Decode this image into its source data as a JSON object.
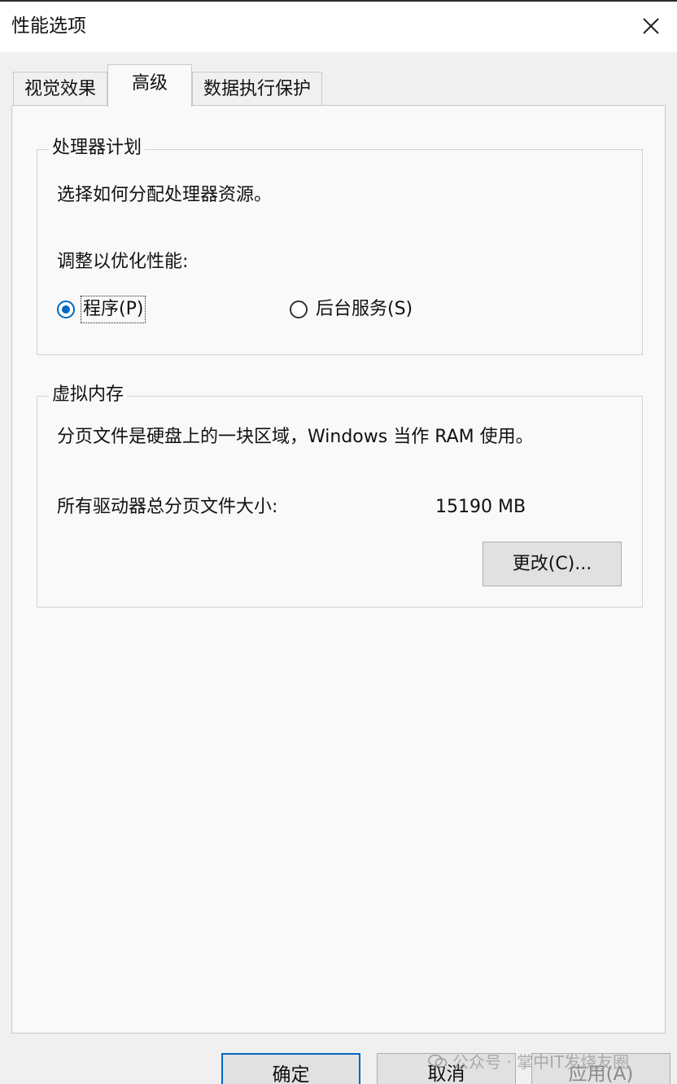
{
  "window": {
    "title": "性能选项",
    "close_icon": "close-icon"
  },
  "tabs": [
    {
      "label": "视觉效果"
    },
    {
      "label": "高级"
    },
    {
      "label": "数据执行保护"
    }
  ],
  "processor": {
    "legend": "处理器计划",
    "description": "选择如何分配处理器资源。",
    "adjust_label": "调整以优化性能:",
    "options": [
      {
        "label": "程序(P)",
        "selected": true
      },
      {
        "label": "后台服务(S)",
        "selected": false
      }
    ]
  },
  "virtual_memory": {
    "legend": "虚拟内存",
    "description": "分页文件是硬盘上的一块区域，Windows 当作 RAM 使用。",
    "total_label": "所有驱动器总分页文件大小:",
    "total_value": "15190 MB",
    "change_button": "更改(C)..."
  },
  "footer": {
    "ok": "确定",
    "cancel": "取消",
    "apply": "应用(A)"
  },
  "watermark": {
    "text": "公众号 · 掌中IT发烧友圈"
  },
  "colors": {
    "accent": "#0067c0",
    "background": "#f0f0f0",
    "panel": "#f9f9f9"
  }
}
